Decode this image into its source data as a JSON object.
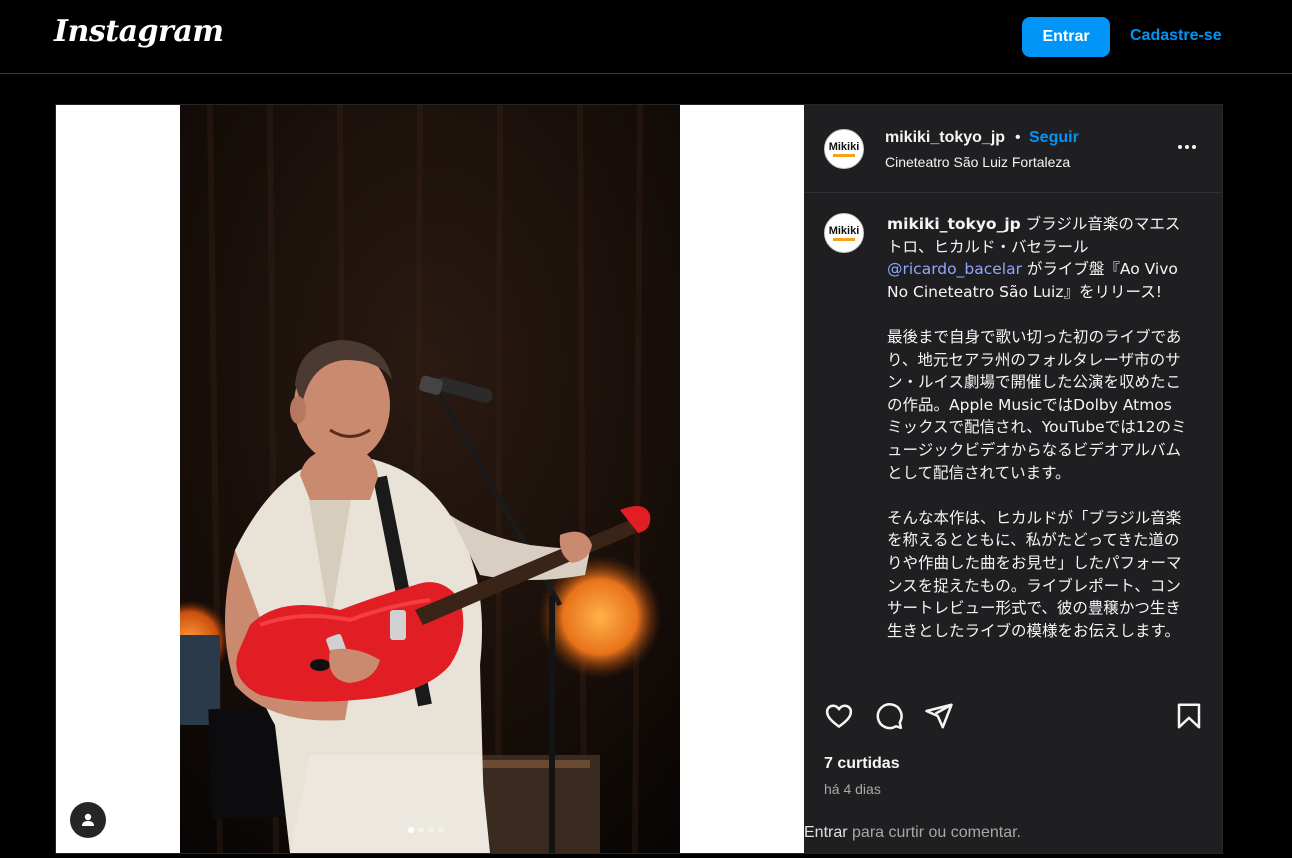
{
  "header": {
    "logo": "Instagram",
    "login_button": "Entrar",
    "signup_link": "Cadastre-se"
  },
  "post": {
    "username": "mikiki_tokyo_jp",
    "separator": "•",
    "follow": "Seguir",
    "location": "Cineteatro São Luiz Fortaleza",
    "avatar_text": "Mikiki",
    "carousel": {
      "total_slides": 4,
      "active_slide": 1
    },
    "caption": {
      "username": "mikiki_tokyo_jp",
      "line1_pre": " ブラジル音楽のマエストロ、ヒカルド・バセラール ",
      "mention": "@ricardo_bacelar",
      "line1_post": " がライブ盤『Ao Vivo No Cineteatro São Luiz』をリリース!",
      "para2": "最後まで自身で歌い切った初のライブであり、地元セアラ州のフォルタレーザ市のサン・ルイス劇場で開催した公演を収めたこの作品。Apple MusicではDolby Atmosミックスで配信され、YouTubeでは12のミュージックビデオからなるビデオアルバムとして配信されています。",
      "para3": "そんな本作は、ヒカルドが「ブラジル音楽を称えるとともに、私がたどってきた道のりや作曲した曲をお見せ」したパフォーマンスを捉えたもの。ライブレポート、コンサートレビュー形式で、彼の豊穣かつ生き生きとしたライブの模様をお伝えします。"
    },
    "likes": "7 curtidas",
    "time": "há 4 dias",
    "footer_login": "Entrar",
    "footer_text": " para curtir ou comentar."
  },
  "icons": {
    "like": "heart-icon",
    "comment": "comment-icon",
    "share": "share-icon",
    "save": "bookmark-icon",
    "more": "more-options-icon",
    "next": "chevron-right-icon",
    "tag": "user-tag-icon"
  },
  "colors": {
    "accent": "#0095f6",
    "background": "#000000",
    "panel": "#1f1f22",
    "mention": "#8fa6ff",
    "secondary_text": "#a8a8a8"
  }
}
